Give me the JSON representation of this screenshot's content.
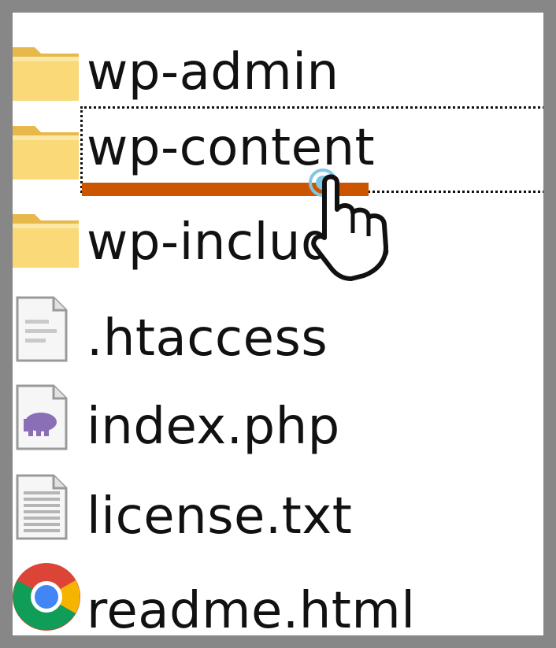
{
  "files": [
    {
      "name": "wp-admin",
      "icon": "folder-icon"
    },
    {
      "name": "wp-content",
      "icon": "folder-icon",
      "selected": true
    },
    {
      "name": "wp-includes",
      "icon": "folder-icon"
    },
    {
      "name": ".htaccess",
      "icon": "text-file-icon"
    },
    {
      "name": "index.php",
      "icon": "php-file-icon"
    },
    {
      "name": "license.txt",
      "icon": "text-file-icon"
    },
    {
      "name": "readme.html",
      "icon": "chrome-icon"
    }
  ],
  "colors": {
    "highlight_underline": "#cc5500",
    "folder": "#f7d36a",
    "php_icon": "#8a6fb6"
  },
  "cursor": "hand-pointer-icon"
}
